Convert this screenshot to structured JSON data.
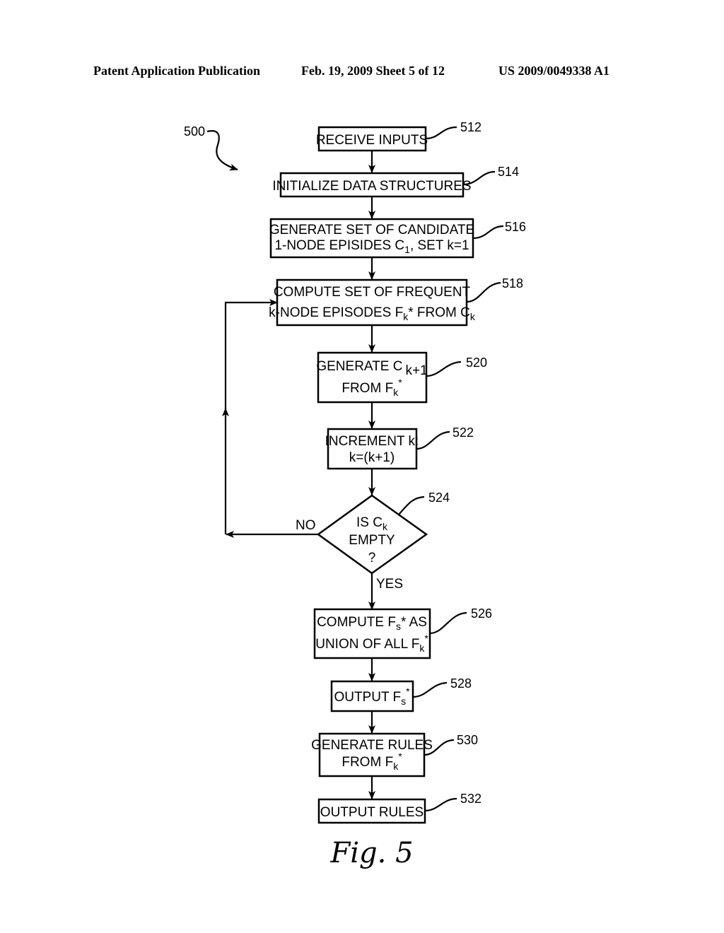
{
  "header": {
    "publication": "Patent Application Publication",
    "date_sheet": "Feb. 19, 2009   Sheet 5 of 12",
    "number": "US 2009/0049338 A1"
  },
  "figure": {
    "ref": "500",
    "caption": "Fig. 5",
    "steps": [
      {
        "ref": "512",
        "lines": [
          "RECEIVE INPUTS"
        ]
      },
      {
        "ref": "514",
        "lines": [
          "INITIALIZE DATA STRUCTURES"
        ]
      },
      {
        "ref": "516",
        "lines": [
          "GENERATE SET OF CANDIDATE",
          "1-NODE EPISIDES C",
          "1",
          ", SET k=1"
        ]
      },
      {
        "ref": "518",
        "lines": [
          "COMPUTE SET OF FREQUENT",
          "k-NODE EPISODES F",
          "k",
          "* FROM C",
          "k"
        ]
      },
      {
        "ref": "520",
        "lines": [
          "GENERATE C",
          "k+1",
          "FROM F",
          "k",
          "*"
        ]
      },
      {
        "ref": "522",
        "lines": [
          "INCREMENT k:",
          "k=(k+1)"
        ]
      },
      {
        "ref": "524",
        "lines": [
          "IS C",
          "k",
          "EMPTY",
          "?"
        ]
      },
      {
        "ref": "526",
        "lines": [
          "COMPUTE F",
          "s",
          "* AS",
          "UNION OF ALL F",
          "k",
          "*"
        ]
      },
      {
        "ref": "528",
        "lines": [
          "OUTPUT F",
          "s",
          "*"
        ]
      },
      {
        "ref": "530",
        "lines": [
          "GENERATE RULES",
          "FROM F",
          "k",
          "*"
        ]
      },
      {
        "ref": "532",
        "lines": [
          "OUTPUT RULES"
        ]
      }
    ],
    "branch_no": "NO",
    "branch_yes": "YES"
  }
}
